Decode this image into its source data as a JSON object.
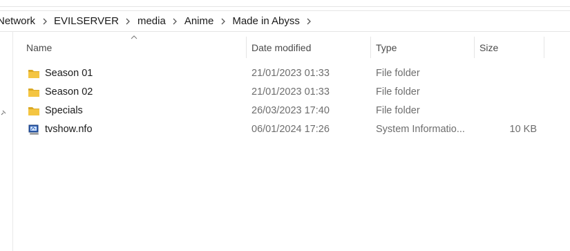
{
  "breadcrumb": [
    "Network",
    "EVILSERVER",
    "media",
    "Anime",
    "Made in Abyss"
  ],
  "columns": {
    "name": "Name",
    "date": "Date modified",
    "type": "Type",
    "size": "Size"
  },
  "sort": {
    "column": "name",
    "direction": "ascending"
  },
  "files": [
    {
      "name": "Season 01",
      "date": "21/01/2023 01:33",
      "type": "File folder",
      "size": "",
      "icon": "folder-icon"
    },
    {
      "name": "Season 02",
      "date": "21/01/2023 01:33",
      "type": "File folder",
      "size": "",
      "icon": "folder-icon"
    },
    {
      "name": "Specials",
      "date": "26/03/2023 17:40",
      "type": "File folder",
      "size": "",
      "icon": "folder-icon"
    },
    {
      "name": "tvshow.nfo",
      "date": "06/01/2024 17:26",
      "type": "System Informatio...",
      "size": "10 KB",
      "icon": "system-info-file-icon"
    }
  ],
  "colors": {
    "folder": "#f4c542",
    "folderDark": "#dba924",
    "text": "#1a1a1a",
    "muted": "#6d6d6d"
  }
}
